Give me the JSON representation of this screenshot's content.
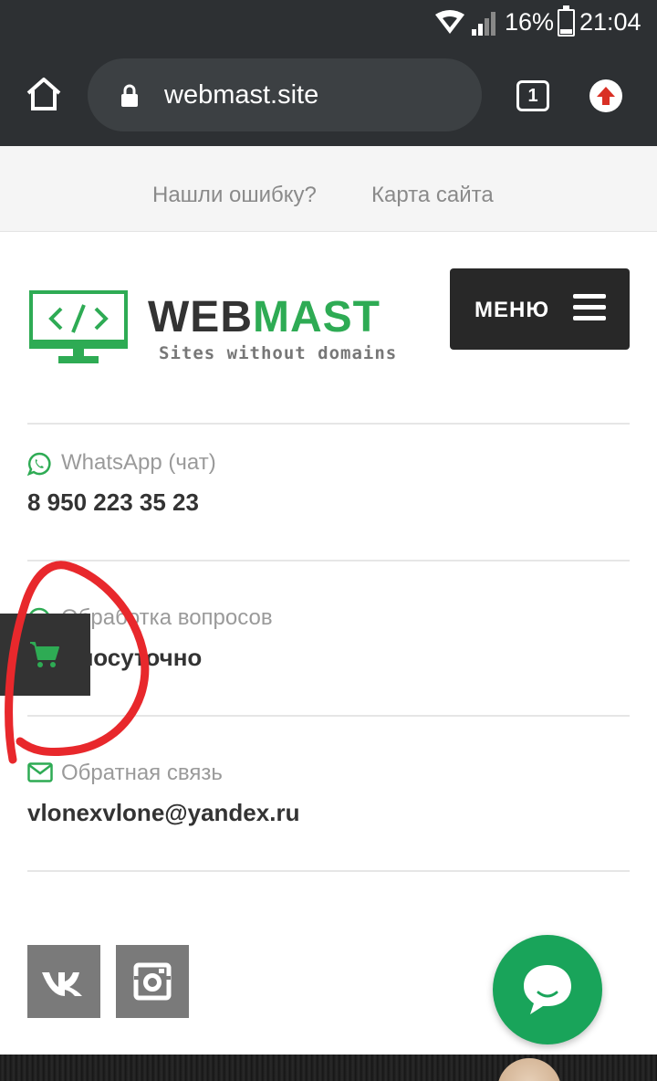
{
  "status_bar": {
    "battery_percent": "16%",
    "time": "21:04"
  },
  "browser": {
    "url": "webmast.site",
    "tab_count": "1"
  },
  "top_links": {
    "report_error": "Нашли ошибку?",
    "sitemap": "Карта сайта"
  },
  "logo": {
    "word_dark": "WEB",
    "word_green": "MAST",
    "tagline": "Sites without domains"
  },
  "menu": {
    "label": "МЕНЮ"
  },
  "contacts": [
    {
      "icon": "whatsapp-icon",
      "label": "WhatsApp (чат)",
      "value": "8 950 223 35 23"
    },
    {
      "icon": "clock-icon",
      "label": "Обработка вопросов",
      "value": "Круглосуточно"
    },
    {
      "icon": "envelope-icon",
      "label": "Обратная связь",
      "value": "vlonexvlone@yandex.ru"
    }
  ],
  "colors": {
    "brand_green": "#2eab54",
    "chat_green": "#19a45a",
    "dark": "#282828",
    "annotation_red": "#e8282c"
  }
}
